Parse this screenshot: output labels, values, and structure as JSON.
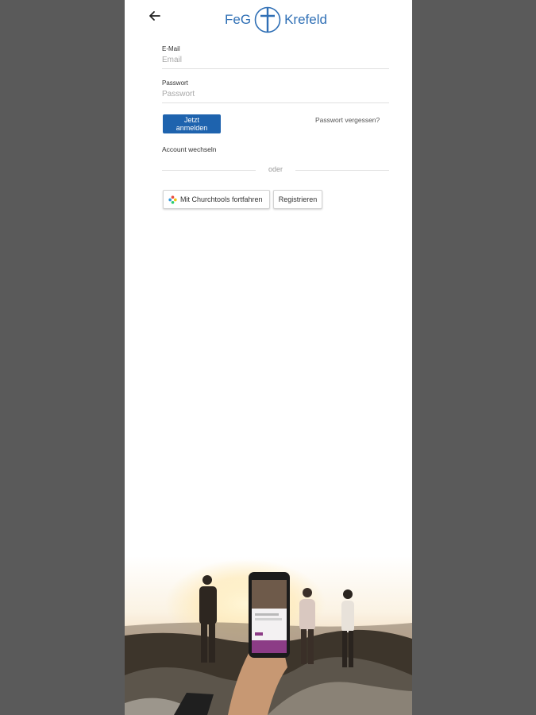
{
  "header": {
    "logo_left": "FeG",
    "logo_right": "Krefeld"
  },
  "form": {
    "email_label": "E-Mail",
    "email_placeholder": "Email",
    "password_label": "Passwort",
    "password_placeholder": "Passwort",
    "login_button": "Jetzt anmelden",
    "forgot_password": "Passwort vergessen?",
    "switch_account": "Account wechseln",
    "divider_text": "oder",
    "churchtools_button": "Mit Churchtools fortfahren",
    "register_button": "Registrieren"
  },
  "colors": {
    "brand_blue": "#2f6fb5",
    "button_blue": "#1e63ae",
    "backdrop": "#5a5a5a"
  },
  "icons": {
    "back": "arrow-left-icon",
    "logo": "cross-circle-icon",
    "churchtools": "churchtools-icon"
  }
}
